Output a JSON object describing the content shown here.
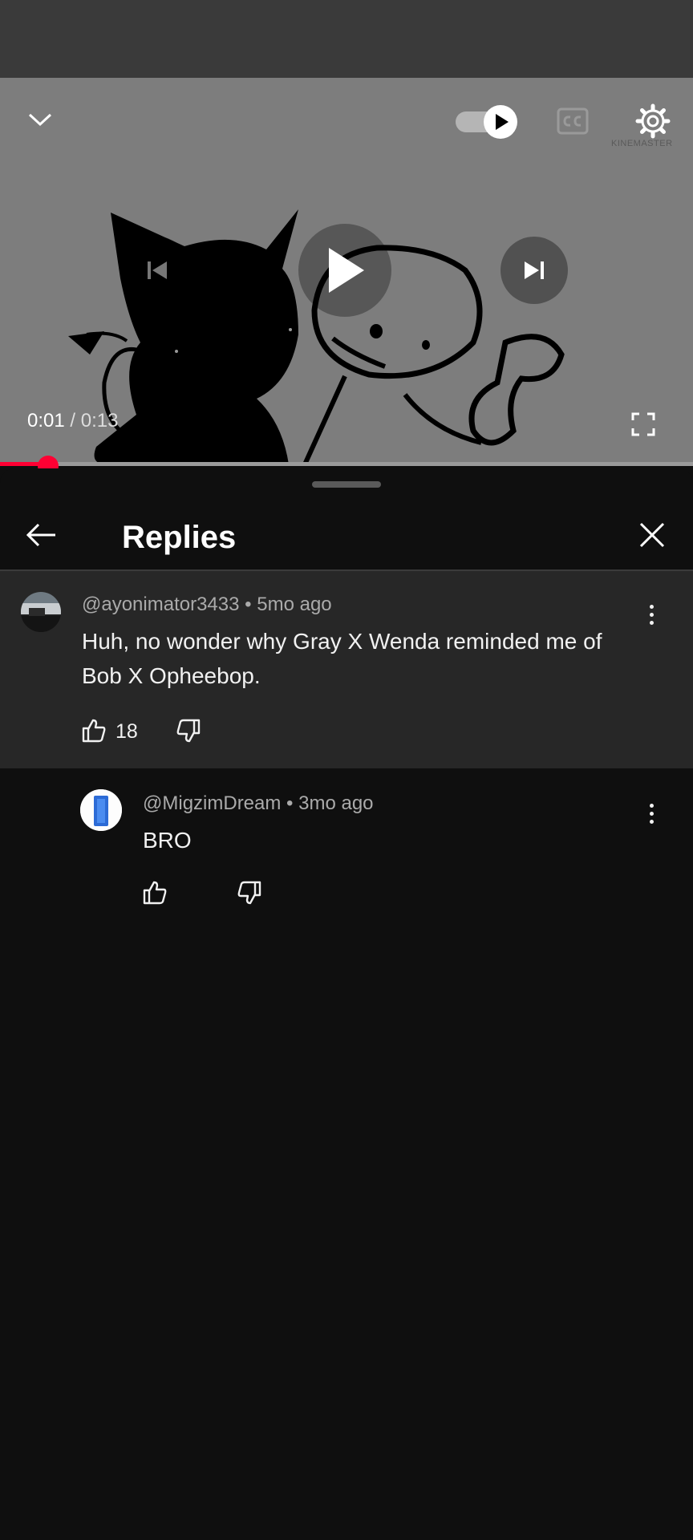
{
  "player": {
    "current_time": "0:01",
    "separator": "/",
    "duration": "0:13",
    "progress_fraction": 0.07,
    "autoplay_on": true,
    "watermark": "KINEMASTER"
  },
  "sheet": {
    "title": "Replies"
  },
  "parent_comment": {
    "author": "@ayonimator3433",
    "age": "5mo ago",
    "text": "Huh, no wonder why Gray X Wenda reminded me of Bob X Opheebop.",
    "likes": "18"
  },
  "replies": [
    {
      "author": "@MigzimDream",
      "age": "3mo ago",
      "text": "BRO",
      "likes": ""
    }
  ],
  "colors": {
    "accent": "#ff0033",
    "background": "#0f0f0f",
    "highlight": "#272727"
  }
}
